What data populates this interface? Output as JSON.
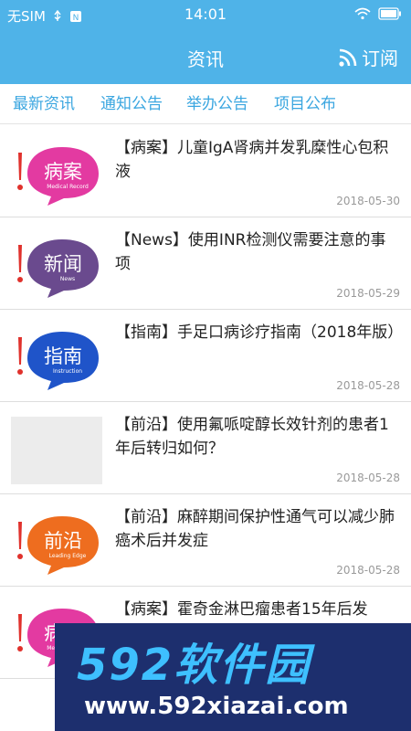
{
  "status_bar": {
    "carrier": "无SIM",
    "time": "14:01"
  },
  "header": {
    "title": "资讯",
    "subscribe_label": "订阅"
  },
  "tabs": [
    {
      "label": "最新资讯",
      "active": true
    },
    {
      "label": "通知公告",
      "active": false
    },
    {
      "label": "举办公告",
      "active": false
    },
    {
      "label": "项目公布",
      "active": false
    }
  ],
  "news": [
    {
      "title": "【病案】儿童IgA肾病并发乳糜性心包积液",
      "date": "2018-05-30",
      "thumb": {
        "main": "病案",
        "sub": "Medical Record",
        "color": "#e33aa1"
      }
    },
    {
      "title": "【News】使用INR检测仪需要注意的事项",
      "date": "2018-05-29",
      "thumb": {
        "main": "新闻",
        "sub": "News",
        "color": "#6a4a8e"
      }
    },
    {
      "title": "【指南】手足口病诊疗指南（2018年版）",
      "date": "2018-05-28",
      "thumb": {
        "main": "指南",
        "sub": "Instruction",
        "color": "#1f54c9"
      }
    },
    {
      "title": "【前沿】使用氟哌啶醇长效针剂的患者1年后转归如何？",
      "date": "2018-05-28",
      "thumb": null
    },
    {
      "title": "【前沿】麻醉期间保护性通气可以减少肺癌术后并发症",
      "date": "2018-05-28",
      "thumb": {
        "main": "前沿",
        "sub": "Leading Edge",
        "color": "#ee6d1f"
      }
    },
    {
      "title": "【病案】霍奇金淋巴瘤患者15年后发",
      "date": "",
      "thumb": {
        "main": "病案",
        "sub": "Medical Record",
        "color": "#e33aa1"
      }
    }
  ],
  "watermark": {
    "title": "592软件园",
    "url": "www.592xiazai.com"
  }
}
